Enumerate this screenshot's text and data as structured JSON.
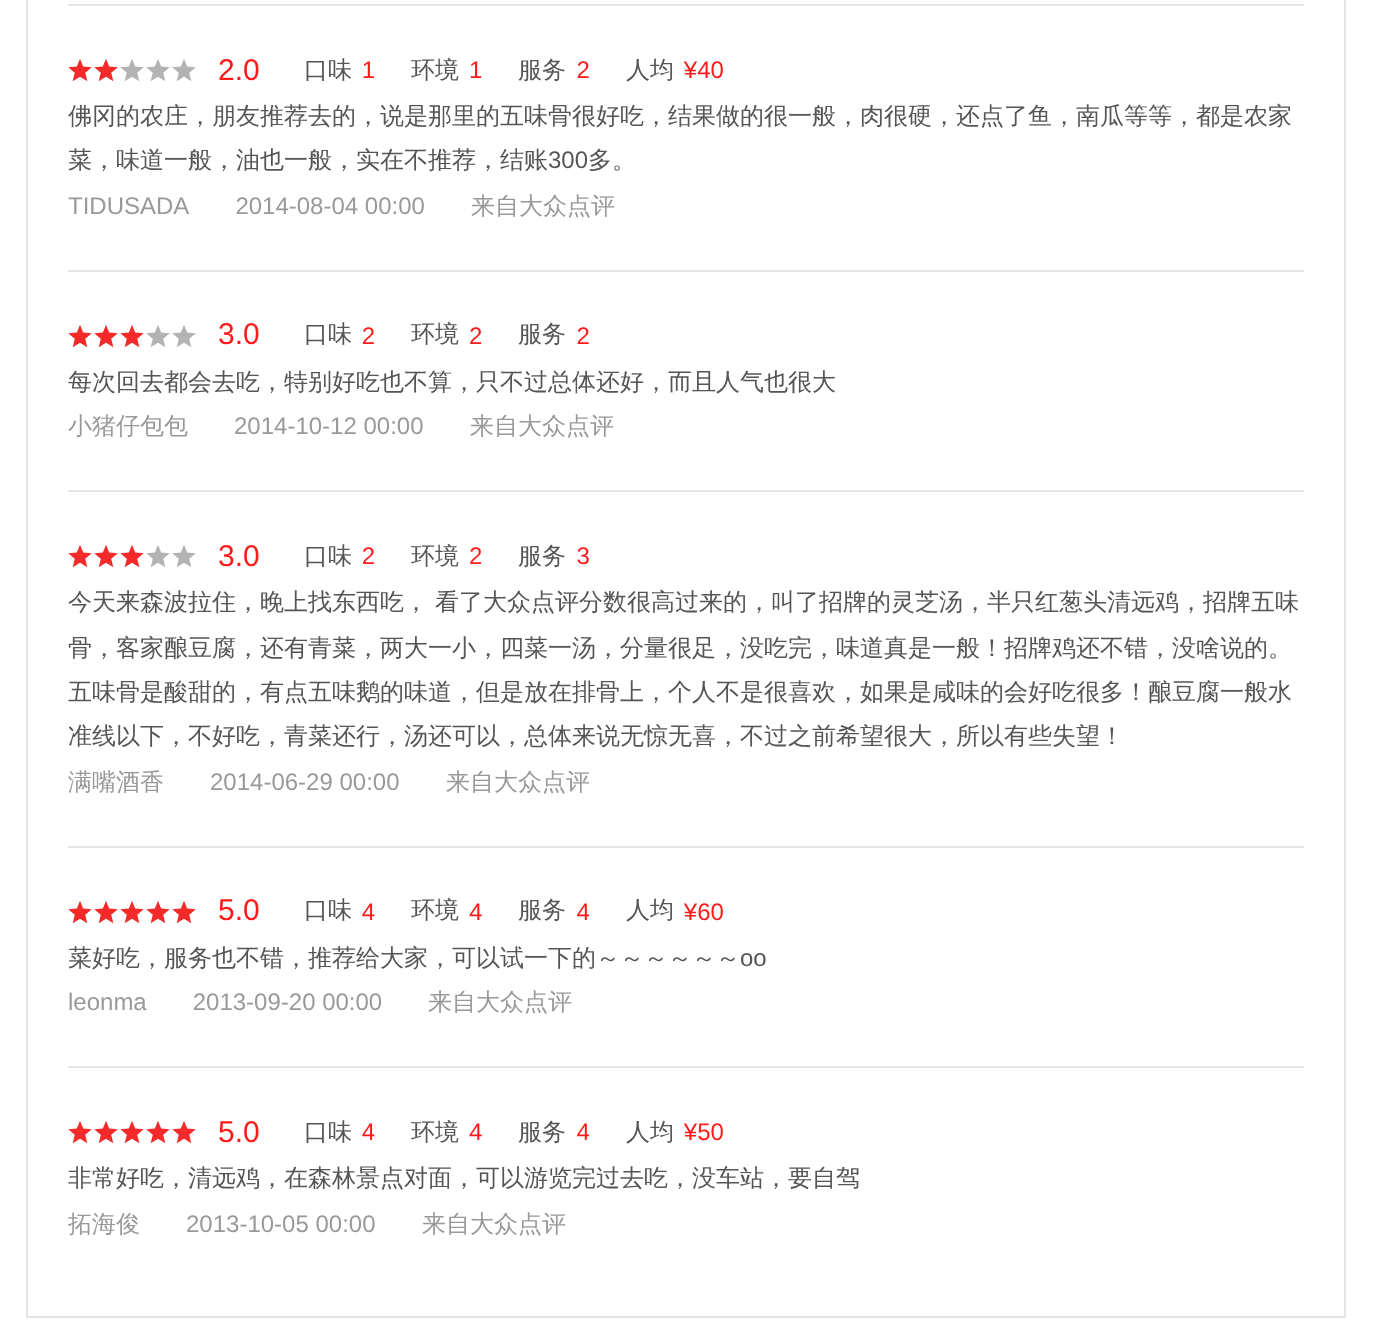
{
  "reviews": [
    {
      "stars": 2,
      "score": "2.0",
      "ratings": [
        {
          "label": "口味",
          "value": "1"
        },
        {
          "label": "环境",
          "value": "1"
        },
        {
          "label": "服务",
          "value": "2"
        },
        {
          "label": "人均",
          "value": "¥40"
        }
      ],
      "text": "佛冈的农庄，朋友推荐去的，说是那里的五味骨很好吃，结果做的很一般，肉很硬，还点了鱼，南瓜等等，都是农家菜，味道一般，油也一般，实在不推荐，结账300多。",
      "author": "TIDUSADA",
      "date": "2014-08-04 00:00",
      "source": "来自大众点评"
    },
    {
      "stars": 3,
      "score": "3.0",
      "ratings": [
        {
          "label": "口味",
          "value": "2"
        },
        {
          "label": "环境",
          "value": "2"
        },
        {
          "label": "服务",
          "value": "2"
        }
      ],
      "text": "每次回去都会去吃，特别好吃也不算，只不过总体还好，而且人气也很大",
      "author": "小猪仔包包",
      "date": "2014-10-12 00:00",
      "source": "来自大众点评"
    },
    {
      "stars": 3,
      "score": "3.0",
      "ratings": [
        {
          "label": "口味",
          "value": "2"
        },
        {
          "label": "环境",
          "value": "2"
        },
        {
          "label": "服务",
          "value": "3"
        }
      ],
      "text": "今天来森波拉住，晚上找东西吃， 看了大众点评分数很高过来的，叫了招牌的灵芝汤，半只红葱头清远鸡，招牌五味骨，客家酿豆腐，还有青菜，两大一小，四菜一汤，分量很足，没吃完，味道真是一般！招牌鸡还不错，没啥说的。五味骨是酸甜的，有点五味鹅的味道，但是放在排骨上，个人不是很喜欢，如果是咸味的会好吃很多！酿豆腐一般水准线以下，不好吃，青菜还行，汤还可以，总体来说无惊无喜，不过之前希望很大，所以有些失望！",
      "author": "满嘴酒香",
      "date": "2014-06-29 00:00",
      "source": "来自大众点评"
    },
    {
      "stars": 5,
      "score": "5.0",
      "ratings": [
        {
          "label": "口味",
          "value": "4"
        },
        {
          "label": "环境",
          "value": "4"
        },
        {
          "label": "服务",
          "value": "4"
        },
        {
          "label": "人均",
          "value": "¥60"
        }
      ],
      "text": "菜好吃，服务也不错，推荐给大家，可以试一下的～～～～～～oo",
      "author": "leonma",
      "date": "2013-09-20 00:00",
      "source": "来自大众点评"
    },
    {
      "stars": 5,
      "score": "5.0",
      "ratings": [
        {
          "label": "口味",
          "value": "4"
        },
        {
          "label": "环境",
          "value": "4"
        },
        {
          "label": "服务",
          "value": "4"
        },
        {
          "label": "人均",
          "value": "¥50"
        }
      ],
      "text": "非常好吃，清远鸡，在森林景点对面，可以游览完过去吃，没车站，要自驾",
      "author": "拓海俊",
      "date": "2013-10-05 00:00",
      "source": "来自大众点评"
    }
  ]
}
